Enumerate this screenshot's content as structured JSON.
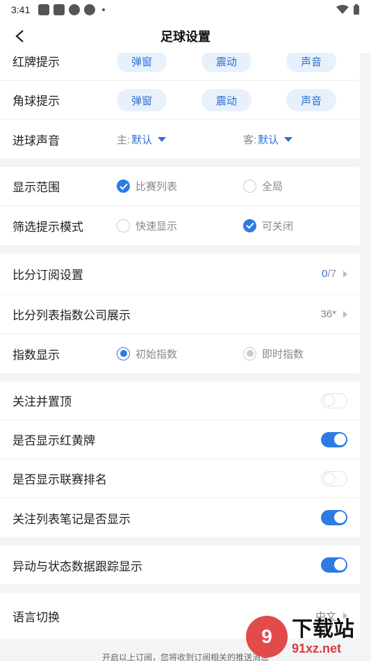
{
  "status": {
    "time": "3:41"
  },
  "nav": {
    "title": "足球设置"
  },
  "alerts": {
    "red_card": {
      "label": "红牌提示",
      "options": [
        "弹窗",
        "震动",
        "声音"
      ]
    },
    "corner": {
      "label": "角球提示",
      "options": [
        "弹窗",
        "震动",
        "声音"
      ]
    },
    "goal_sound": {
      "label": "进球声音",
      "home_prefix": "主:",
      "home_value": "默认",
      "away_prefix": "客:",
      "away_value": "默认"
    }
  },
  "display": {
    "range": {
      "label": "显示范围",
      "opt1": "比赛列表",
      "opt2": "全局",
      "selected": "比赛列表"
    },
    "filter_mode": {
      "label": "筛选提示模式",
      "opt1": "快速显示",
      "opt2": "可关闭",
      "selected": "可关闭"
    }
  },
  "score": {
    "subscribe": {
      "label": "比分订阅设置",
      "count": "0",
      "total": "/7"
    },
    "index_company": {
      "label": "比分列表指数公司展示",
      "value": "36*"
    },
    "index_display": {
      "label": "指数显示",
      "opt1": "初始指数",
      "opt2": "即时指数",
      "selected": "初始指数"
    }
  },
  "toggles": [
    {
      "label": "关注并置顶",
      "on": false
    },
    {
      "label": "是否显示红黄牌",
      "on": true
    },
    {
      "label": "是否显示联赛排名",
      "on": false
    },
    {
      "label": "关注列表笔记是否显示",
      "on": true
    }
  ],
  "tracking": {
    "label": "异动与状态数据跟踪显示",
    "on": true
  },
  "language": {
    "label": "语言切换",
    "value": "中文"
  },
  "footer": {
    "text": "开启以上订阅，您将收到订阅相关的推送消息"
  },
  "watermark": {
    "logo": "9",
    "name": "下载站",
    "domain": "91xz.net"
  },
  "colors": {
    "accent": "#2c7be5",
    "pill_bg": "#e8f1fb",
    "bg": "#f3f4f6"
  }
}
